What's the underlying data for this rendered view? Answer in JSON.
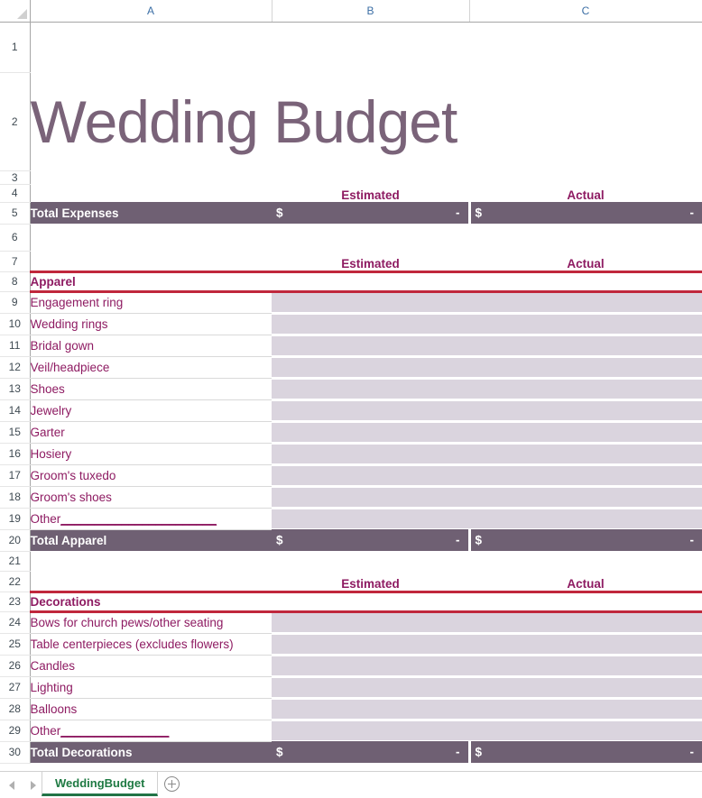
{
  "app": {
    "title": "Wedding Budget"
  },
  "columns": {
    "headers": [
      "A",
      "B",
      "C"
    ],
    "corner_icon": "select-all-triangle-icon"
  },
  "row_numbers": [
    "1",
    "2",
    "3",
    "4",
    "5",
    "6",
    "7",
    "8",
    "9",
    "10",
    "11",
    "12",
    "13",
    "14",
    "15",
    "16",
    "17",
    "18",
    "19",
    "20",
    "21",
    "22",
    "23",
    "24",
    "25",
    "26",
    "27",
    "28",
    "29",
    "30"
  ],
  "labels": {
    "estimated": "Estimated",
    "actual": "Actual",
    "currency_symbol": "$",
    "empty_value_dash": "-"
  },
  "summary": {
    "row": "5",
    "label": "Total Expenses",
    "estimated_currency": "$",
    "estimated_value": "-",
    "actual_currency": "$",
    "actual_value": "-"
  },
  "sections": [
    {
      "header_row": "8",
      "name": "Apparel",
      "estimated_header": "Estimated",
      "actual_header": "Actual",
      "items": [
        {
          "row": "9",
          "label": "Engagement ring",
          "estimated": "",
          "actual": ""
        },
        {
          "row": "10",
          "label": "Wedding rings",
          "estimated": "",
          "actual": ""
        },
        {
          "row": "11",
          "label": "Bridal gown",
          "estimated": "",
          "actual": ""
        },
        {
          "row": "12",
          "label": "Veil/headpiece",
          "estimated": "",
          "actual": ""
        },
        {
          "row": "13",
          "label": "Shoes",
          "estimated": "",
          "actual": ""
        },
        {
          "row": "14",
          "label": "Jewelry",
          "estimated": "",
          "actual": ""
        },
        {
          "row": "15",
          "label": "Garter",
          "estimated": "",
          "actual": ""
        },
        {
          "row": "16",
          "label": "Hosiery",
          "estimated": "",
          "actual": ""
        },
        {
          "row": "17",
          "label": "Groom's tuxedo",
          "estimated": "",
          "actual": ""
        },
        {
          "row": "18",
          "label": "Groom's shoes",
          "estimated": "",
          "actual": ""
        },
        {
          "row": "19",
          "label": "Other_______________________",
          "estimated": "",
          "actual": ""
        }
      ],
      "total": {
        "row": "20",
        "label": "Total Apparel",
        "estimated_currency": "$",
        "estimated_value": "-",
        "actual_currency": "$",
        "actual_value": "-"
      }
    },
    {
      "header_row": "23",
      "name": "Decorations",
      "estimated_header": "Estimated",
      "actual_header": "Actual",
      "items": [
        {
          "row": "24",
          "label": "Bows for church pews/other seating",
          "estimated": "",
          "actual": ""
        },
        {
          "row": "25",
          "label": "Table centerpieces (excludes flowers)",
          "estimated": "",
          "actual": ""
        },
        {
          "row": "26",
          "label": "Candles",
          "estimated": "",
          "actual": ""
        },
        {
          "row": "27",
          "label": "Lighting",
          "estimated": "",
          "actual": ""
        },
        {
          "row": "28",
          "label": "Balloons",
          "estimated": "",
          "actual": ""
        },
        {
          "row": "29",
          "label": "Other________________",
          "estimated": "",
          "actual": ""
        }
      ],
      "total": {
        "row": "30",
        "label": "Total Decorations",
        "estimated_currency": "$",
        "estimated_value": "-",
        "actual_currency": "$",
        "actual_value": "-"
      }
    }
  ],
  "tabbar": {
    "prev_icon": "arrow-left-icon",
    "next_icon": "arrow-right-icon",
    "sheets": [
      {
        "name": "WeddingBudget",
        "active": true
      }
    ],
    "add_sheet_icon": "plus-circle-icon"
  },
  "colors": {
    "title_purple": "#7A6379",
    "heading_magenta": "#8E1B62",
    "total_bar": "#6F6073",
    "rule_red": "#C0273C",
    "input_fill": "#DAD4DE",
    "tab_green": "#217346"
  }
}
